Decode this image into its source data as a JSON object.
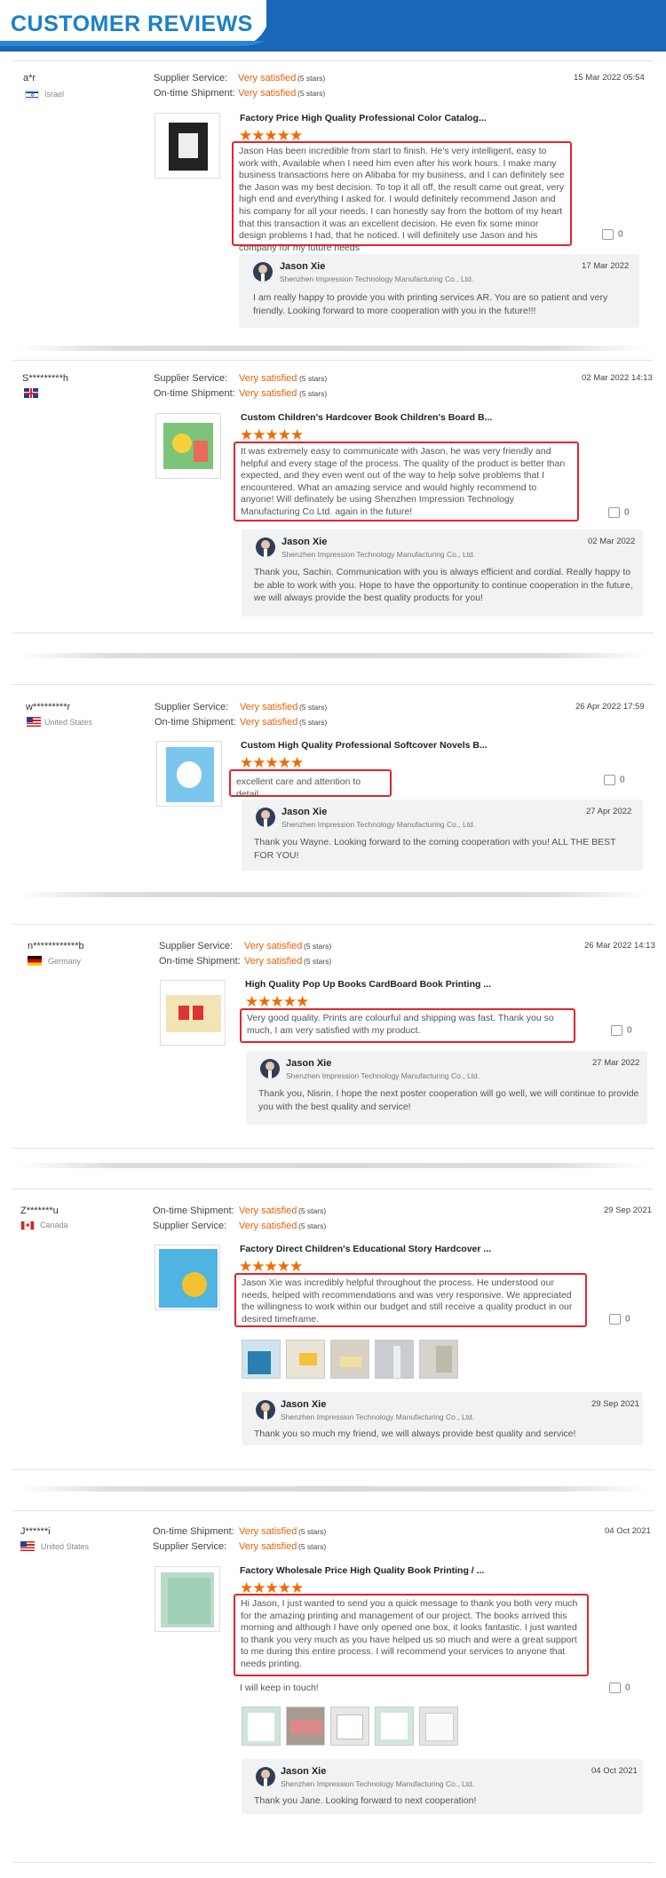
{
  "header": {
    "title": "CUSTOMER REVIEWS"
  },
  "labels": {
    "supplier_service": "Supplier Service:",
    "ontime_shipment": "On-time Shipment:",
    "rating_value": "Very satisfied",
    "stars_text": "(5 stars)",
    "star_glyphs": "★★★★★"
  },
  "reviews": [
    {
      "user": "a*r",
      "country": "Israel",
      "date": "15 Mar 2022 05:54",
      "product": "Factory Price High Quality Professional Color Catalog...",
      "text": "Jason Has been incredible from start to finish. He's very intelligent, easy to work with, Available when I need him even after his work hours. I make many business transactions here on Alibaba for my business, and I can definitely see the Jason was my best decision. To top it all off, the result came out great, very high end and everything I asked for. I would definitely recommend Jason and his company for all your needs, I can honestly say from the bottom of my heart that this transaction it was an excellent decision. He even fix some minor design problems I had, that he noticed. I will definitely use Jason and his company for my future needs",
      "likes": "0",
      "reply": {
        "name": "Jason Xie",
        "company": "Shenzhen Impression Technology Manufacturing Co., Ltd.",
        "date": "17 Mar 2022",
        "text": "I am really happy to provide you with printing services AR. You are so patient and very friendly. Looking forward to more cooperation with you in the future!!!"
      }
    },
    {
      "user": "S*********h",
      "country": "",
      "date": "02 Mar 2022 14:13",
      "product": "Custom Children's Hardcover Book Children's Board B...",
      "text": "It was extremely easy to communicate with Jason, he was very friendly and helpful and every stage of the process. The quality of the product is better than expected, and they even went out of the way to help solve problems that I encountered. What an amazing service and would highly recommend to anyone! Will definately be using Shenzhen Impression Technology Manufacturing Co Ltd. again in the future!",
      "likes": "0",
      "reply": {
        "name": "Jason Xie",
        "company": "Shenzhen Impression Technology Manufacturing Co., Ltd.",
        "date": "02 Mar 2022",
        "text": "Thank you, Sachin. Communication with you is always efficient and cordial. Really happy to be able to work with you. Hope to have the opportunity to continue cooperation in the future, we will always provide the best quality products for you!"
      }
    },
    {
      "user": "w*********r",
      "country": "United States",
      "date": "26 Apr 2022 17:59",
      "product": "Custom High Quality Professional Softcover Novels B...",
      "text": "excellent care and attention to detail",
      "likes": "0",
      "reply": {
        "name": "Jason Xie",
        "company": "Shenzhen Impression Technology Manufacturing Co., Ltd.",
        "date": "27 Apr 2022",
        "text": "Thank you Wayne. Looking forward to the coming cooperation with you! ALL THE BEST FOR YOU!"
      }
    },
    {
      "user": "n************b",
      "country": "Germany",
      "date": "26 Mar 2022 14:13",
      "product": "High Quality Pop Up Books CardBoard Book Printing ...",
      "text": "Very good quality. Prints are colourful and shipping was fast. Thank you so much, I am very satisfied with my product.",
      "likes": "0",
      "reply": {
        "name": "Jason Xie",
        "company": "Shenzhen Impression Technology Manufacturing Co., Ltd.",
        "date": "27 Mar 2022",
        "text": "Thank you, Nisrin. I hope the next poster cooperation will go well, we will continue to provide you with the best quality and service!"
      }
    },
    {
      "user": "Z*******u",
      "country": "Canada",
      "date": "29 Sep 2021",
      "product": "Factory Direct Children's Educational Story Hardcover ...",
      "text": "Jason Xie was incredibly helpful throughout the process. He understood our needs, helped with recommendations and was very responsive. We appreciated the willingness to work within our budget and still receive a quality product in our desired timeframe.",
      "likes": "0",
      "reply": {
        "name": "Jason Xie",
        "company": "Shenzhen Impression Technology Manufacturing Co., Ltd.",
        "date": "29 Sep 2021",
        "text": "Thank you so much my friend, we will always provide best quality and service!"
      }
    },
    {
      "user": "J******i",
      "country": "United States",
      "date": "04 Oct 2021",
      "product": "Factory Wholesale Price High Quality Book Printing / ...",
      "text": "Hi Jason, I just wanted to send you a quick message to thank you both very much for the amazing printing and management of our project.  The books arrived this morning and although I have only opened one box, it looks fantastic.   I just wanted to thank you very much as you have helped us so much and were a great support to me during this entire process.  I will recommend your services to anyone that needs printing.",
      "extra": "I will keep in touch!",
      "likes": "0",
      "reply": {
        "name": "Jason Xie",
        "company": "Shenzhen Impression Technology Manufacturing Co., Ltd.",
        "date": "04 Oct 2021",
        "text": "Thank you Jane. Looking forward to next cooperation!"
      }
    }
  ]
}
